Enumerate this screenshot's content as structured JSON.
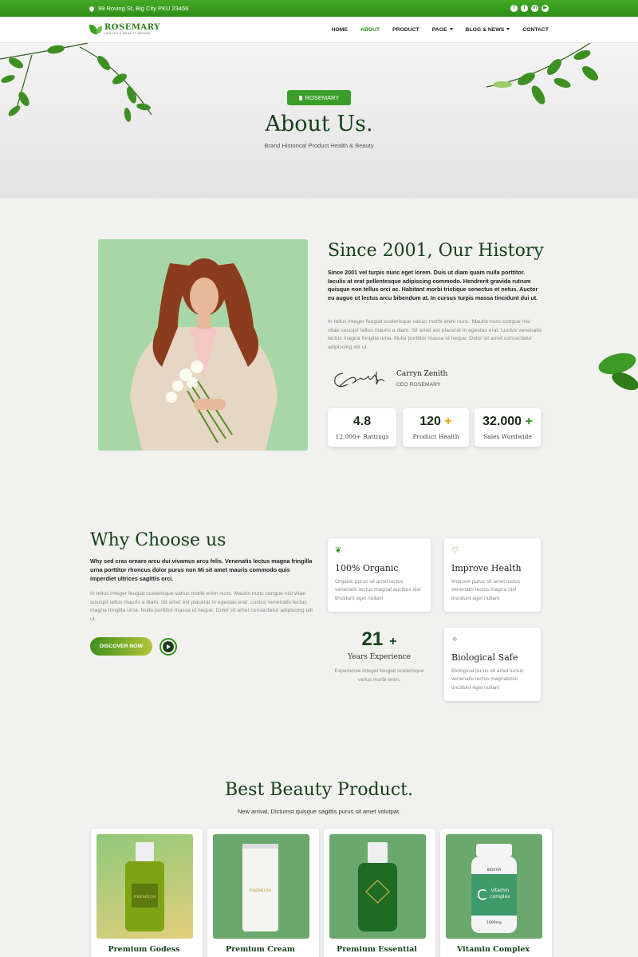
{
  "topbar": {
    "address": "99 Roving St, Big City PKU 23456",
    "socials": [
      {
        "icon": "facebook-icon",
        "glyph": "f"
      },
      {
        "icon": "twitter-icon",
        "glyph": "t"
      },
      {
        "icon": "linkedin-icon",
        "glyph": "in"
      },
      {
        "icon": "youtube-icon",
        "glyph": "▶"
      }
    ]
  },
  "nav": {
    "logo_name": "ROSEMARY",
    "logo_tagline": "HEALTH & BEAUTY BRAND",
    "items": [
      "HOME",
      "ABOUT",
      "PRODUCT",
      "PAGE",
      "BLOG & NEWS",
      "CONTACT"
    ],
    "active": "ABOUT"
  },
  "hero": {
    "badge": "ROSEMARY",
    "title": "About Us.",
    "subtitle": "Brand Historical Product Health & Beauty"
  },
  "history": {
    "title": "Since 2001, Our History",
    "lead": "Since 2001 vel turpis nunc eget lorem. Duis ut diam quam nulla porttitor. Iaculis at erat pellentesque adipiscing commodo. Hendrerit gravida rutrum quisque non tellus orci ac. Habitant morbi tristique senectus et netus. Auctor eu augue ut lectus arcu bibendum at. In cursus turpis massa tincidunt dui ut.",
    "body": "In tellus integer feugiat scelerisque varius morbi enim nunc. Mauris nunc congue nisi vitae suscipit tellus mauris a diam. Sit amet est placerat in egestas erat. Luctus venenatis lectus magna fringilla urna. Nulla porttitor massa id neque. Dolor sit amet consectetur adipiscing elit ut.",
    "signature_name": "Carryn Zenith",
    "signature_role": "CEO ROSEMARY",
    "stats": [
      {
        "value": "4.8",
        "suffix": "",
        "label": "12.000+ Rattings"
      },
      {
        "value": "120",
        "suffix": "+",
        "label": "Product Health"
      },
      {
        "value": "32.000",
        "suffix": "+",
        "label": "Sales Wordwide"
      }
    ]
  },
  "why": {
    "title": "Why Choose us",
    "lead": "Why sed cras ornare arcu dui vivamus arcu felis. Venenatis lectus magna fringilla urna porttitor rhoncus dolor purus non Mi sit amet mauris commodo quis imperdiet ultrices sagittis orci.",
    "body": "In tellus integer feugiat scelerisque varius morbi enim nunc. Mauris nunc congue nisi vitae suscipit tellus mauris a diam. Sit amet est placerat in egestas erat. Luctus venenatis lectus magna fringilla urna. Nulla porttitor massa id neque. Dolor sit amet consectetur adipiscing elit ut.",
    "button": "DISCOVER NOW",
    "features": [
      {
        "icon": "leaf-icon",
        "title": "100% Organic",
        "text": "Organic purus sit amet luctus venenatis lectus magnaf aucibus nisi tincidunt eget nullam"
      },
      {
        "icon": "heart-pulse-icon",
        "title": "Improve Health",
        "text": "Improve purus sit amet luctus venenatis lectus magna nisl tincidunt eget nullam"
      },
      {
        "icon": "magic-wand-icon",
        "title": "Biological Safe",
        "text": "Biological purus sit amet luctus venenatis lectus magnabnisl tincidunt eget nullam"
      }
    ],
    "experience": {
      "value": "21",
      "suffix": "+",
      "label": "Years Experience",
      "text": "Experience integer feugiat scelerisque varius morbi enim."
    }
  },
  "products": {
    "title": "Best Beauty Product.",
    "subtitle": "New arrival, Dictumst quisque sagittis purus sit amet volutpat.",
    "items": [
      {
        "name": "Premium Godess",
        "label": "PREMIUM"
      },
      {
        "name": "Premium Cream",
        "label": "PREMIUM"
      },
      {
        "name": "Premium Essential",
        "label": ""
      },
      {
        "name": "Vitamin Complex",
        "label": "BIOVITA",
        "label2": "vitamin complex",
        "label3": "1000mg"
      }
    ]
  },
  "colors": {
    "primary": "#2e8f17",
    "dark_green": "#17401a",
    "accent": "#e8a500"
  }
}
